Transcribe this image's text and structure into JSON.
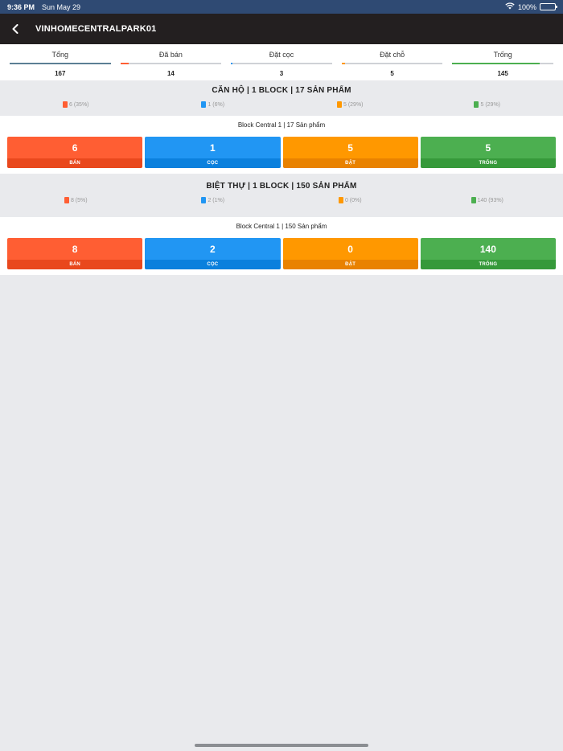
{
  "status": {
    "time": "9:36 PM",
    "date": "Sun May 29",
    "battery": "100%"
  },
  "nav": {
    "title": "VINHOMECENTRALPARK01"
  },
  "colors": {
    "ban": "#ff5e33",
    "coc": "#2196f3",
    "dat": "#ff9800",
    "trong": "#4caf50",
    "total": "#5b7f94"
  },
  "summary": [
    {
      "label": "Tổng",
      "value": "167",
      "color": "#5b7f94",
      "fraction": 1.0
    },
    {
      "label": "Đã bán",
      "value": "14",
      "color": "#ff5e33",
      "fraction": 0.084
    },
    {
      "label": "Đặt cọc",
      "value": "3",
      "color": "#2196f3",
      "fraction": 0.018
    },
    {
      "label": "Đặt chỗ",
      "value": "5",
      "color": "#ff9800",
      "fraction": 0.03
    },
    {
      "label": "Trống",
      "value": "145",
      "color": "#4caf50",
      "fraction": 0.868
    }
  ],
  "groups": [
    {
      "title": "CĂN HỘ | 1 BLOCK | 17 SẢN PHẨM",
      "legend": [
        "6 (35%)",
        "1 (6%)",
        "5 (29%)",
        "5 (29%)"
      ],
      "block": {
        "title": "Block Central 1 | 17 Sản phẩm",
        "tiles": [
          {
            "value": "6",
            "caption": "BÁN"
          },
          {
            "value": "1",
            "caption": "CỌC"
          },
          {
            "value": "5",
            "caption": "ĐẶT"
          },
          {
            "value": "5",
            "caption": "TRỐNG"
          }
        ]
      }
    },
    {
      "title": "BIỆT THỰ | 1 BLOCK | 150 SẢN PHẨM",
      "legend": [
        "8 (5%)",
        "2 (1%)",
        "0 (0%)",
        "140 (93%)"
      ],
      "block": {
        "title": "Block Central 1 | 150 Sản phẩm",
        "tiles": [
          {
            "value": "8",
            "caption": "BÁN"
          },
          {
            "value": "2",
            "caption": "CỌC"
          },
          {
            "value": "0",
            "caption": "ĐẶT"
          },
          {
            "value": "140",
            "caption": "TRỐNG"
          }
        ]
      }
    }
  ]
}
